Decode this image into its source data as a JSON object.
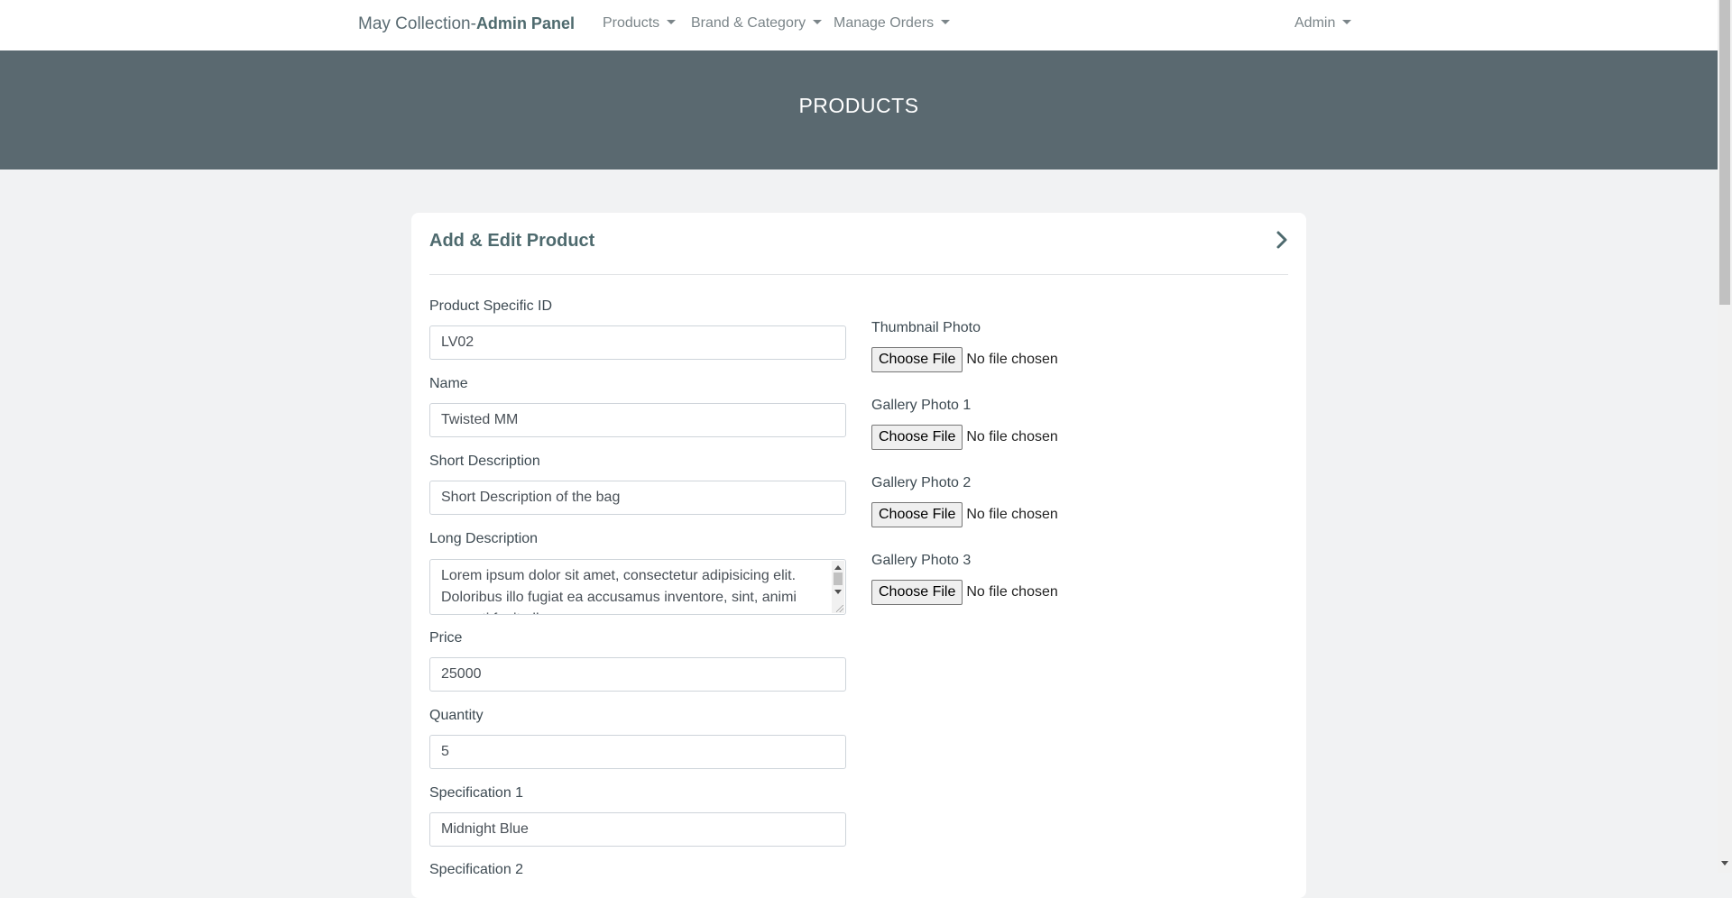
{
  "navbar": {
    "brand_prefix": "May Collection-",
    "brand_suffix": "Admin Panel",
    "items": [
      {
        "label": "Products"
      },
      {
        "label": "Brand & Category"
      },
      {
        "label": "Manage Orders"
      }
    ],
    "user_menu": "Admin"
  },
  "hero": {
    "title": "PRODUCTS"
  },
  "card": {
    "title": "Add & Edit Product"
  },
  "form": {
    "product_id": {
      "label": "Product Specific ID",
      "value": "LV02"
    },
    "name": {
      "label": "Name",
      "value": "Twisted MM"
    },
    "short_description": {
      "label": "Short Description",
      "value": "Short Description of the bag"
    },
    "long_description": {
      "label": "Long Description",
      "value": "Lorem ipsum dolor sit amet, consectetur adipisicing elit. Doloribus illo fugiat ea accusamus inventore, sint, animi corrupti fugit ullam"
    },
    "price": {
      "label": "Price",
      "value": "25000"
    },
    "quantity": {
      "label": "Quantity",
      "value": "5"
    },
    "specification_1": {
      "label": "Specification 1",
      "value": "Midnight Blue"
    },
    "specification_2": {
      "label": "Specification 2"
    }
  },
  "uploads": {
    "button_label": "Choose File",
    "status": "No file chosen",
    "fields": [
      {
        "label": "Thumbnail Photo"
      },
      {
        "label": "Gallery Photo 1"
      },
      {
        "label": "Gallery Photo 2"
      },
      {
        "label": "Gallery Photo 3"
      }
    ]
  },
  "icons": {
    "expand": "chevron-right-icon",
    "dropdown": "caret-down-icon"
  },
  "colors": {
    "hero_background": "#5a6970",
    "accent_text": "#4e6a6e",
    "page_background": "#f1f2f3"
  }
}
